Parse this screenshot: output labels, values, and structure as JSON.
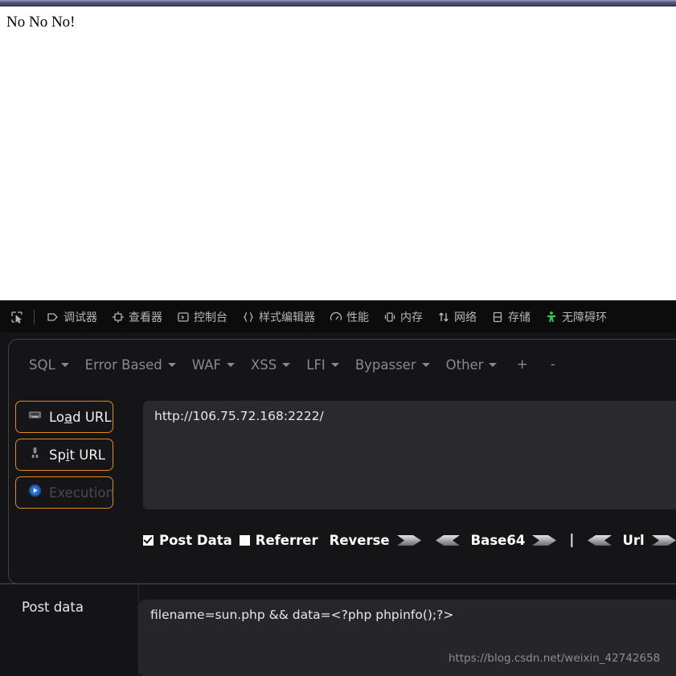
{
  "page": {
    "body_text": "No No No!"
  },
  "devtools": {
    "picker_icon": "element-picker-icon",
    "tabs": [
      {
        "label": "调试器",
        "icon": "debugger-icon",
        "name": "tab-debugger"
      },
      {
        "label": "查看器",
        "icon": "inspector-icon",
        "name": "tab-inspector"
      },
      {
        "label": "控制台",
        "icon": "console-icon",
        "name": "tab-console"
      },
      {
        "label": "样式编辑器",
        "icon": "style-editor-icon",
        "name": "tab-style-editor"
      },
      {
        "label": "性能",
        "icon": "performance-icon",
        "name": "tab-performance"
      },
      {
        "label": "内存",
        "icon": "memory-icon",
        "name": "tab-memory"
      },
      {
        "label": "网络",
        "icon": "network-icon",
        "name": "tab-network"
      },
      {
        "label": "存储",
        "icon": "storage-icon",
        "name": "tab-storage"
      },
      {
        "label": "无障碍环",
        "icon": "accessibility-icon",
        "name": "tab-accessibility"
      }
    ]
  },
  "hackbar": {
    "menu": [
      {
        "label": "SQL",
        "name": "menu-sql"
      },
      {
        "label": "Error Based",
        "name": "menu-error-based"
      },
      {
        "label": "WAF",
        "name": "menu-waf"
      },
      {
        "label": "XSS",
        "name": "menu-xss"
      },
      {
        "label": "LFI",
        "name": "menu-lfi"
      },
      {
        "label": "Bypasser",
        "name": "menu-bypasser"
      },
      {
        "label": "Other",
        "name": "menu-other"
      }
    ],
    "menu_add": "+",
    "menu_remove": "-",
    "buttons": [
      {
        "label_pre": "Lo",
        "label_accel": "a",
        "label_post": "d URL",
        "icon": "load-url-icon",
        "disabled": false
      },
      {
        "label_pre": "Sp",
        "label_accel": "i",
        "label_post": "t URL",
        "icon": "spit-url-icon",
        "disabled": false
      },
      {
        "label_pre": "",
        "label_accel": "",
        "label_post": "Execution",
        "icon": "execution-play-icon",
        "disabled": true
      }
    ],
    "url_value": "http://106.75.72.168:2222/",
    "options": {
      "post_data_label": "Post Data",
      "post_data_checked": true,
      "referrer_label": "Referrer",
      "referrer_checked": false,
      "reverse_label": "Reverse",
      "base64_label": "Base64",
      "separator": "|",
      "url_label": "Url"
    },
    "post_data_label": "Post data",
    "post_data_value": "filename=sun.php && data=<?php phpinfo();?>"
  },
  "watermark": "https://blog.csdn.net/weixin_42742658",
  "colors": {
    "accent_orange": "#e08a1e",
    "devtools_bg": "#0c0c0d",
    "panel_bg": "#141416",
    "accessibility_green": "#30d158"
  }
}
